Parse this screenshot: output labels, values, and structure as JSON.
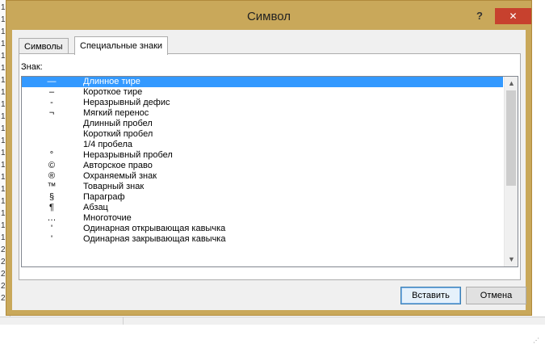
{
  "dialog": {
    "title": "Символ",
    "help_label": "?",
    "close_label": "✕"
  },
  "tabs": [
    {
      "label": "Символы",
      "active": false
    },
    {
      "label": "Специальные знаки",
      "active": true
    }
  ],
  "list": {
    "label": "Знак:",
    "selected_index": 0,
    "items": [
      {
        "symbol": "—",
        "name": "Длинное тире"
      },
      {
        "symbol": "–",
        "name": "Короткое тире"
      },
      {
        "symbol": "-",
        "name": "Неразрывный дефис"
      },
      {
        "symbol": "¬",
        "name": "Мягкий перенос"
      },
      {
        "symbol": "",
        "name": "Длинный пробел"
      },
      {
        "symbol": "",
        "name": "Короткий пробел"
      },
      {
        "symbol": "",
        "name": "1/4 пробела"
      },
      {
        "symbol": "°",
        "name": "Неразрывный пробел"
      },
      {
        "symbol": "©",
        "name": "Авторское право"
      },
      {
        "symbol": "®",
        "name": "Охраняемый знак"
      },
      {
        "symbol": "™",
        "name": "Товарный знак"
      },
      {
        "symbol": "§",
        "name": "Параграф"
      },
      {
        "symbol": "¶",
        "name": "Абзац"
      },
      {
        "symbol": "…",
        "name": "Многоточие"
      },
      {
        "symbol": "'",
        "name": "Одинарная открывающая кавычка"
      },
      {
        "symbol": "'",
        "name": "Одинарная закрывающая кавычка"
      }
    ]
  },
  "scrollbar": {
    "up_icon": "▲",
    "down_icon": "▼"
  },
  "buttons": {
    "insert": "Вставить",
    "cancel": "Отмена"
  },
  "background": {
    "row_numbers": [
      "1",
      "1",
      "1",
      "1",
      "1",
      "1",
      "1",
      "1",
      "1",
      "1",
      "1",
      "1",
      "1",
      "1",
      "1",
      "1",
      "1",
      "1",
      "1",
      "1",
      "2",
      "2",
      "2",
      "2",
      "2"
    ]
  },
  "colors": {
    "window_frame": "#c9a85a",
    "close_button": "#c7412e",
    "selection": "#3399ff"
  }
}
